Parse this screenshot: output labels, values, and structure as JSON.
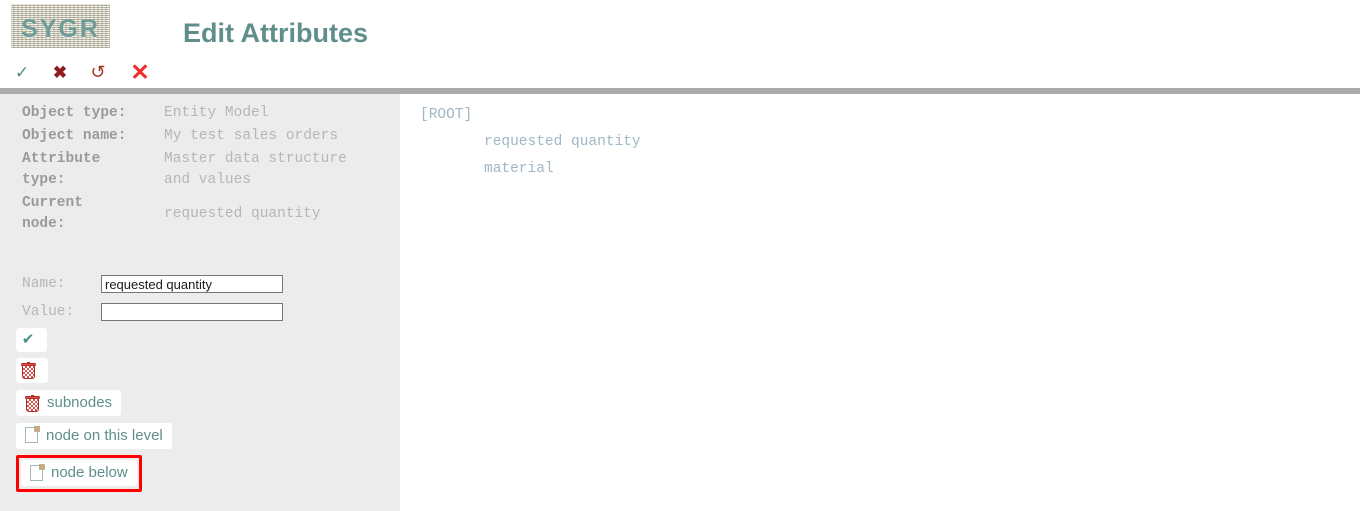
{
  "brand": {
    "logo_text": "SYGR"
  },
  "header": {
    "title": "Edit Attributes"
  },
  "toolbar": {
    "items": [
      {
        "name": "accept-icon",
        "glyph": "✓",
        "label": "accept"
      },
      {
        "name": "reject-icon",
        "glyph": "✖",
        "label": "reject"
      },
      {
        "name": "undo-icon",
        "glyph": "↺",
        "label": "undo"
      },
      {
        "name": "close-icon",
        "glyph": "✕",
        "label": "close"
      }
    ],
    "accept_glyph": "✓",
    "reject_glyph": "✖",
    "undo_glyph": "↺",
    "close_glyph": "✕"
  },
  "info": {
    "rows": [
      {
        "label": "Object type:",
        "value": "Entity Model"
      },
      {
        "label": "Object name:",
        "value": "My test sales orders"
      },
      {
        "label": "Attribute\ntype:",
        "value": "Master data structure\nand values"
      },
      {
        "label": "Current\nnode:",
        "value": "requested quantity"
      }
    ]
  },
  "form": {
    "name_label": "Name:",
    "name_value": "requested quantity",
    "name_placeholder": "",
    "value_label": "Value:",
    "value_value": "",
    "value_placeholder": ""
  },
  "actions": {
    "save_icon": "✔",
    "save_label": "",
    "delete_node_label": "",
    "delete_subnodes_label": "subnodes",
    "add_node_same_level_label": "node on this level",
    "add_node_below_label": "node below"
  },
  "tree": {
    "root_label": "[ROOT]",
    "children": [
      {
        "label": "requested quantity"
      },
      {
        "label": "material"
      }
    ]
  },
  "colors": {
    "brand_teal": "#5f8f8b",
    "separator_gray": "#ababab",
    "panel_gray": "#ececec",
    "tree_text": "#9fb8c4",
    "label_gray": "#9a9a9a",
    "value_gray": "#b6b6b6",
    "highlight_red": "#ff0000",
    "close_red": "#f02c2c"
  }
}
